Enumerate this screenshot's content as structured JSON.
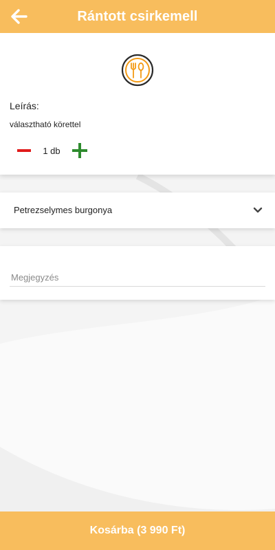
{
  "colors": {
    "accent": "#f8bd5d",
    "minus": "#e01b1b",
    "plus": "#2e8b2e",
    "logo_ring": "#2b2b2b",
    "logo_icon": "#f39a14"
  },
  "header": {
    "title": "Rántott csirkemell",
    "back_icon": "arrow-left-icon"
  },
  "item": {
    "logo_icon": "restaurant-icon",
    "description_label": "Leírás:",
    "description": "választható körettel",
    "quantity": "1 db",
    "minus_icon": "minus-icon",
    "plus_icon": "plus-icon"
  },
  "side_select": {
    "value": "Petrezselymes burgonya",
    "chevron_icon": "chevron-down-icon"
  },
  "note": {
    "placeholder": "Megjegyzés",
    "value": ""
  },
  "footer": {
    "cart_label": "Kosárba (3 990 Ft)"
  }
}
